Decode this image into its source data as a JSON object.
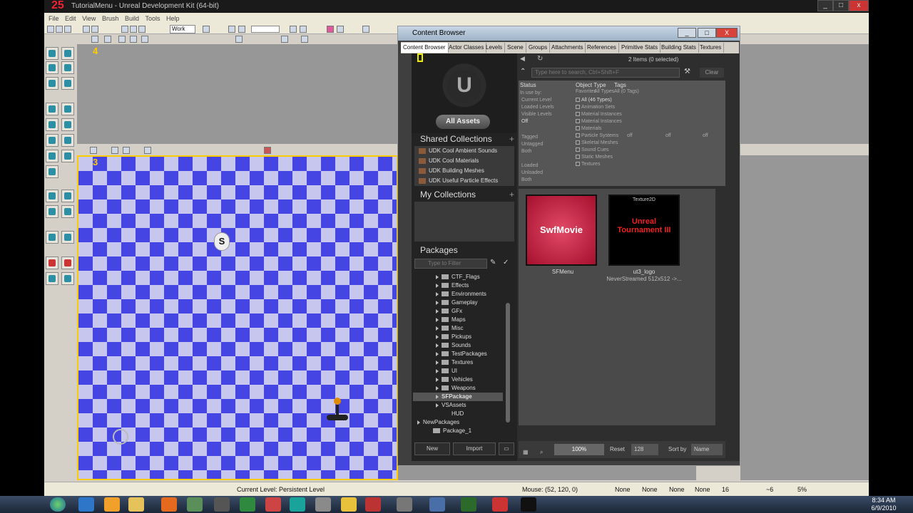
{
  "app": {
    "title": "TutorialMenu - Unreal Development Kit (64-bit)",
    "logo": "25",
    "menu": [
      "File",
      "Edit",
      "View",
      "Brush",
      "Build",
      "Tools",
      "Help"
    ],
    "toolbar_mode": "Work",
    "viewport_labels": {
      "top": "4",
      "perspective": "3"
    },
    "window_controls": [
      "min-icon",
      "max-icon",
      "close-icon"
    ]
  },
  "status": {
    "current_level": "Current Level:  Persistent Level",
    "mouse": "Mouse: (52, 120, 0)",
    "fields": [
      "None",
      "None",
      "None",
      "None",
      "None"
    ],
    "grid": "16",
    "rot": "~6",
    "scale": "5%"
  },
  "content_browser": {
    "title": "Content Browser",
    "tabs": [
      "Content Browser",
      "Actor Classes",
      "Levels",
      "Scene",
      "Groups",
      "Attachments",
      "References",
      "Primitive Stats",
      "Building Stats",
      "Textures"
    ],
    "all_assets": "All Assets",
    "items_count": "2 Items (0 selected)",
    "search_placeholder": "Type here to search, Ctrl+Shift+F",
    "clear_label": "Clear",
    "shared_collections_label": "Shared Collections",
    "shared_collections": [
      "UDK Cool Ambient Sounds",
      "UDK Cool Materials",
      "UDK Building Meshes",
      "UDK Useful Particle Effects"
    ],
    "my_collections_label": "My Collections",
    "packages_label": "Packages",
    "packages_filter_placeholder": "Type to Filter",
    "packages": [
      "CTF_Flags",
      "Effects",
      "Environments",
      "Gameplay",
      "GFx",
      "Maps",
      "Misc",
      "Pickups",
      "Sounds",
      "TestPackages",
      "Textures",
      "UI",
      "Vehicles",
      "Weapons",
      "SFPackage",
      "VSAssets",
      "HUD",
      "NewPackages",
      "Package_1"
    ],
    "new_label": "New",
    "import_label": "Import",
    "filters": {
      "status_head": "Status",
      "in_use_by": "In use by:",
      "status_items": [
        "Current Level",
        "Loaded Levels",
        "Visible Levels",
        "Off",
        "Tagged",
        "Untagged",
        "Both",
        "Loaded",
        "Unloaded",
        "Both"
      ],
      "object_type_head": "Object Type",
      "favorites": "Favorites",
      "all_types": "All Types",
      "object_types": [
        "All (46 Types)",
        "Animation Sets",
        "Material Instances",
        "Material Instances",
        "Materials",
        "Particle Systems",
        "Skeletal Meshes",
        "Sound Cues",
        "Static Meshes",
        "Textures"
      ],
      "tags_head": "Tags",
      "all_tags": "All (0 Tags)",
      "off_labels": [
        "off",
        "off",
        "off"
      ]
    },
    "assets": [
      {
        "type": "",
        "thumb_text": "SwfMovie",
        "name": "SFMenu",
        "info": ""
      },
      {
        "type": "Texture2D",
        "thumb_text": "Unreal Tournament III",
        "name": "ut3_logo",
        "info": "NeverStreamed 512x512 ->..."
      }
    ],
    "zoom": "100%",
    "reset_label": "Reset",
    "thumb_size": "128",
    "sort_by_label": "Sort by",
    "sort_by_value": "Name"
  },
  "taskbar": {
    "time": "8:34 AM",
    "date": "6/9/2010"
  }
}
